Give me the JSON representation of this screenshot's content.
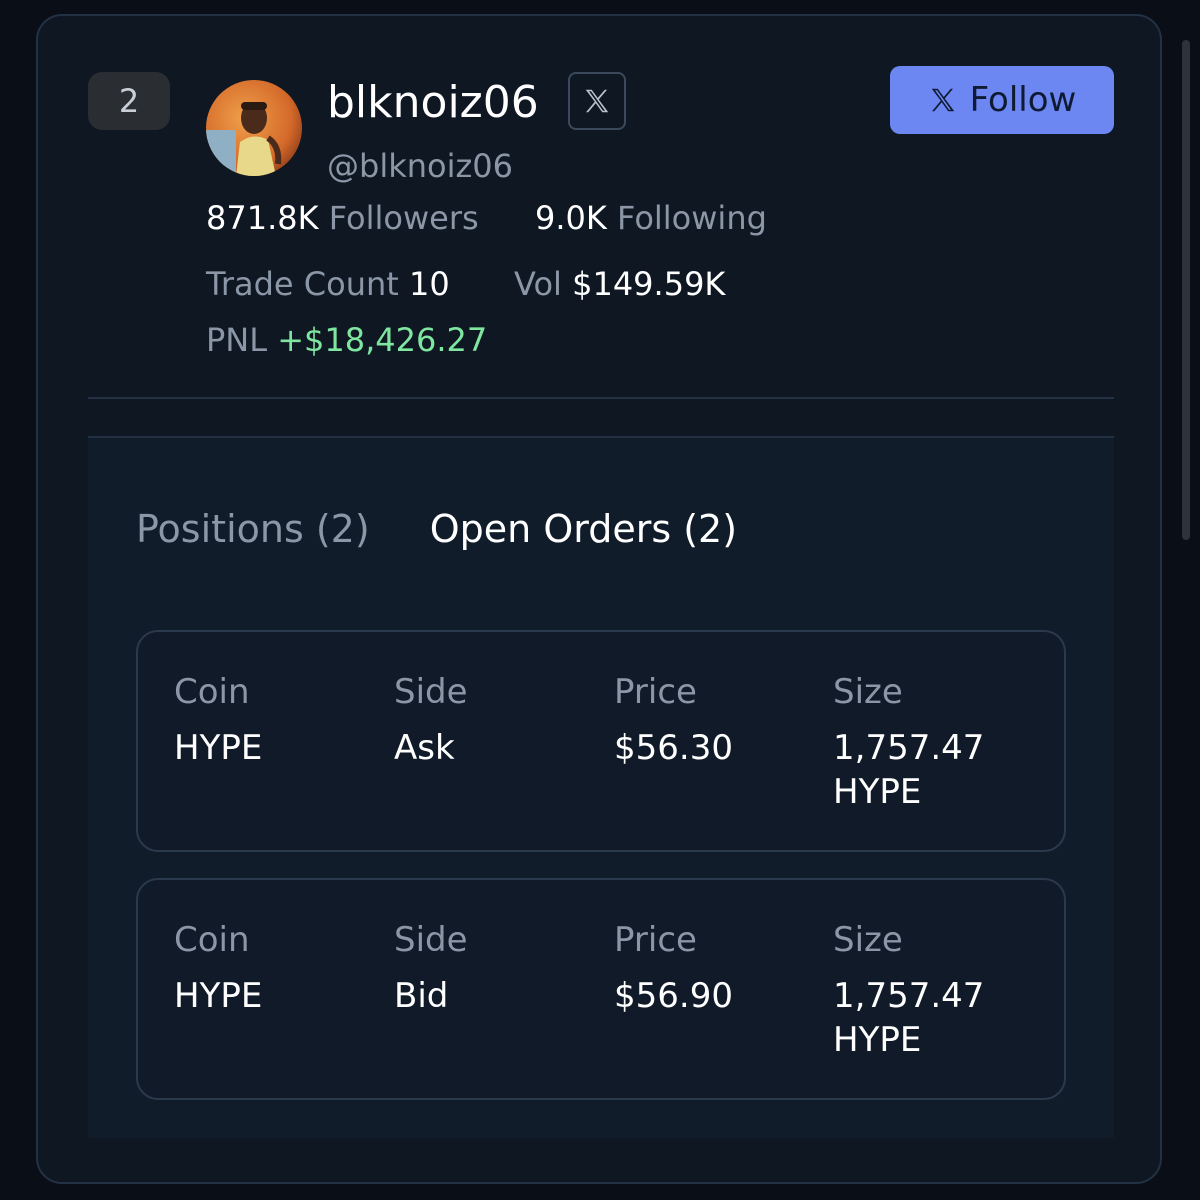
{
  "trader": {
    "rank": "2",
    "username": "blknoiz06",
    "handle": "@blknoiz06",
    "followers_count": "871.8K",
    "followers_label": "Followers",
    "following_count": "9.0K",
    "following_label": "Following",
    "trade_count_label": "Trade Count",
    "trade_count": "10",
    "vol_label": "Vol",
    "vol": "$149.59K",
    "pnl_label": "PNL",
    "pnl": "+$18,426.27"
  },
  "follow_button": {
    "icon": "x-logo-icon",
    "label": "Follow"
  },
  "tabs": [
    {
      "label": "Positions (2)",
      "active": false
    },
    {
      "label": "Open Orders (2)",
      "active": true
    }
  ],
  "orders": {
    "headers": {
      "coin": "Coin",
      "side": "Side",
      "price": "Price",
      "size": "Size"
    },
    "rows": [
      {
        "coin": "HYPE",
        "side": "Ask",
        "price": "$56.30",
        "size_amount": "1,757.47",
        "size_unit": "HYPE"
      },
      {
        "coin": "HYPE",
        "side": "Bid",
        "price": "$56.90",
        "size_amount": "1,757.47",
        "size_unit": "HYPE"
      }
    ]
  },
  "colors": {
    "background": "#0a0f17",
    "card": "#0e1722",
    "accent": "#6c87f2",
    "pnl_positive": "#7fe6a0"
  }
}
